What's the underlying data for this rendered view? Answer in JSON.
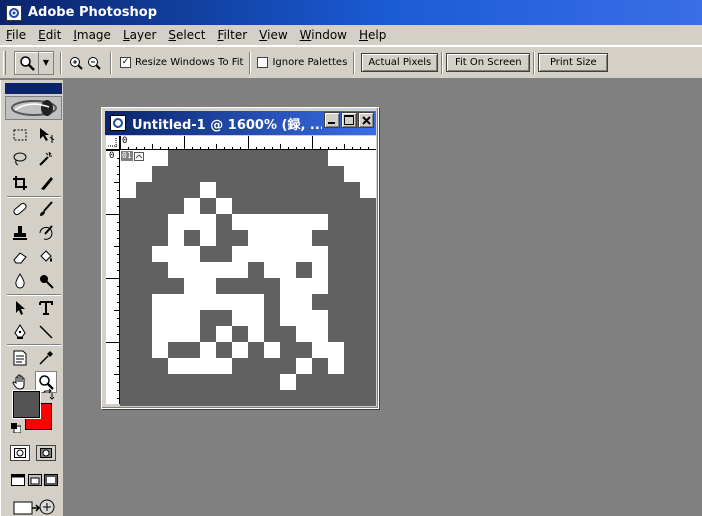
{
  "app": {
    "title": "Adobe Photoshop",
    "icon": "photoshop-app-icon"
  },
  "menu": [
    "File",
    "Edit",
    "Image",
    "Layer",
    "Select",
    "Filter",
    "View",
    "Window",
    "Help"
  ],
  "options": {
    "tool_preset_icon": "zoom-tool-icon",
    "zoom_in_icon": "zoom-in-icon",
    "zoom_out_icon": "zoom-out-icon",
    "resize_windows_label": "Resize Windows To Fit",
    "resize_windows_checked": true,
    "ignore_palettes_label": "Ignore Palettes",
    "ignore_palettes_checked": false,
    "buttons": [
      "Actual Pixels",
      "Fit On Screen",
      "Print Size"
    ]
  },
  "toolbox": {
    "active_tool": "zoom-tool",
    "foreground_color": "#555555",
    "background_color": "#ff0000",
    "tools": [
      "rectangular-marquee-icon",
      "move-icon",
      "lasso-icon",
      "magic-wand-icon",
      "crop-icon",
      "slice-icon",
      "healing-brush-icon",
      "brush-icon",
      "clone-stamp-icon",
      "history-brush-icon",
      "eraser-icon",
      "paint-bucket-icon",
      "blur-icon",
      "dodge-icon",
      "path-selection-icon",
      "type-icon",
      "pen-icon",
      "line-icon",
      "notes-icon",
      "eyedropper-icon",
      "hand-icon",
      "zoom-icon"
    ]
  },
  "document": {
    "title": "Untitled-1 @ 1600% (録, ...",
    "ruler_top_origin": "0",
    "ruler_left_origin": "0",
    "layer_badge": "01",
    "colors": {
      "dark": "#616161",
      "light": "#ffffff"
    },
    "pixels": [
      "0001111111111000",
      "0011111111111100",
      "0111101111111110",
      "1111010111111111",
      "1110001000000111",
      "1110101100001111",
      "1100011000000111",
      "1110000010010111",
      "1111001111000111",
      "1100000001001111",
      "1100011001000111",
      "1100010101100111",
      "1101101010110011",
      "1110000111101011",
      "1111111111011111",
      "1111111111111111"
    ]
  }
}
